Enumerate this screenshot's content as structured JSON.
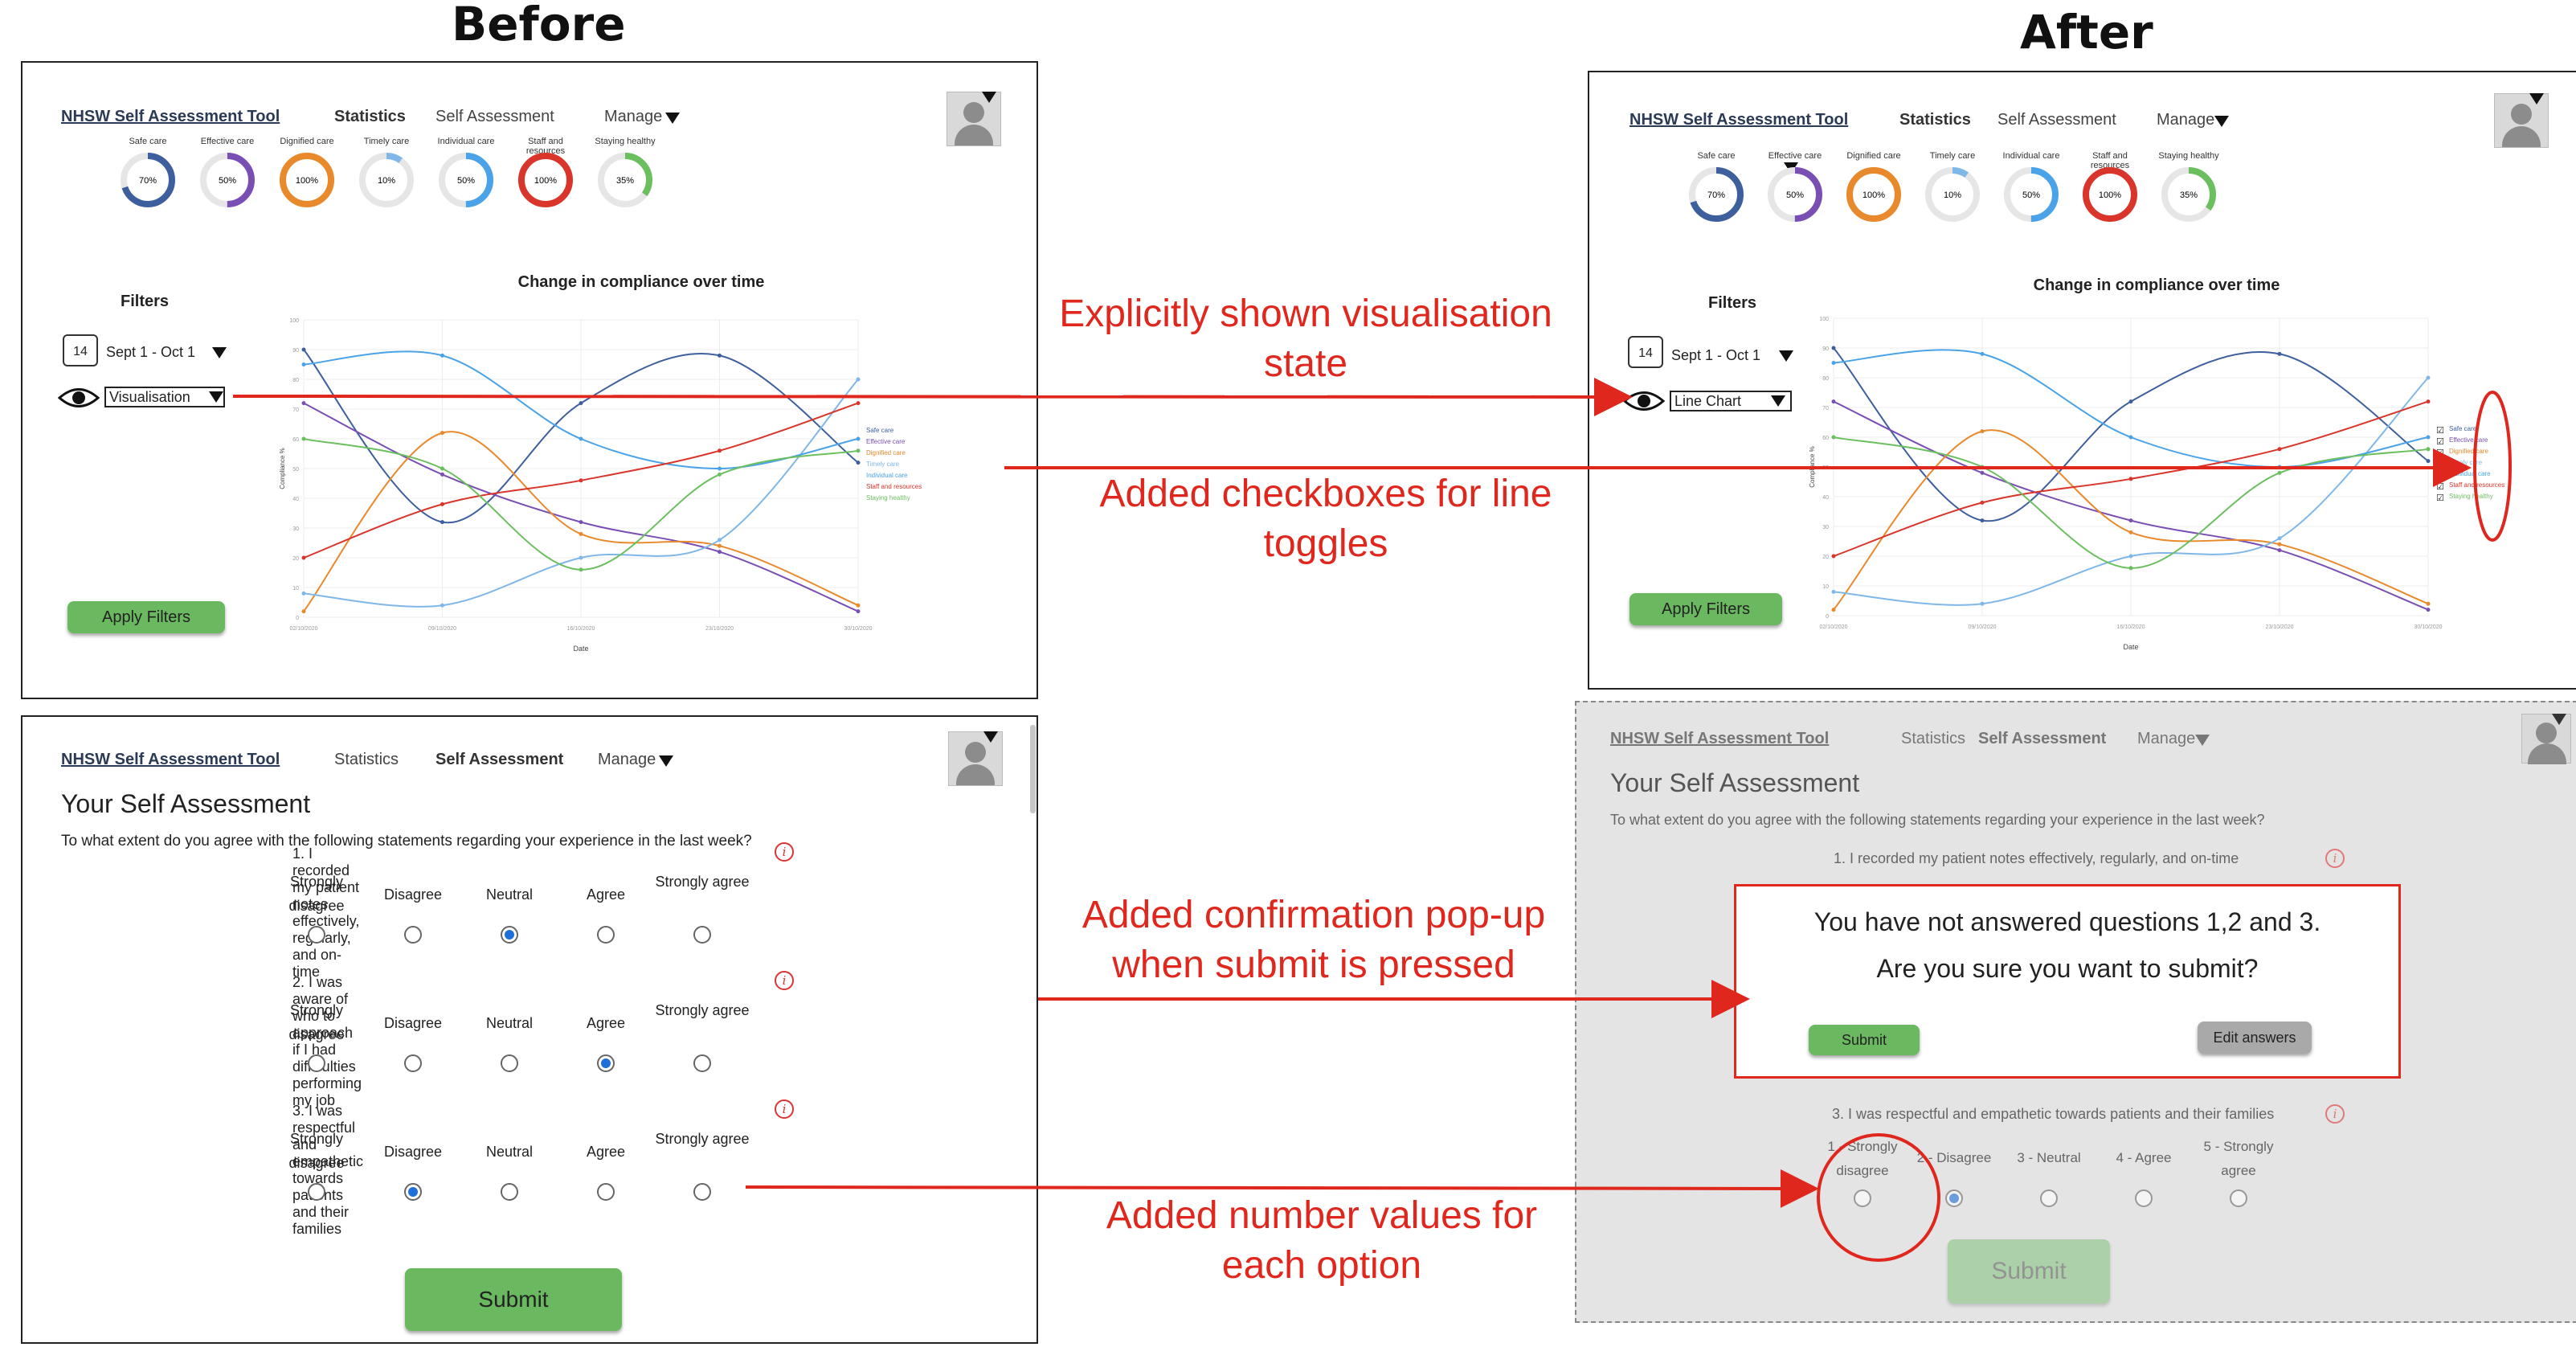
{
  "titles": {
    "before": "Before",
    "after": "After"
  },
  "app": {
    "title": "NHSW Self Assessment Tool",
    "nav": [
      "Statistics",
      "Self Assessment",
      "Manage"
    ]
  },
  "donuts": [
    {
      "label": "Safe care",
      "value": "70%",
      "color": "#3e5f9e"
    },
    {
      "label": "Effective care",
      "value": "50%",
      "color": "#7a4fb4"
    },
    {
      "label": "Dignified care",
      "value": "100%",
      "color": "#e8892c"
    },
    {
      "label": "Timely care",
      "value": "10%",
      "color": "#7fb7e8"
    },
    {
      "label": "Individual care",
      "value": "50%",
      "color": "#4aa3e8"
    },
    {
      "label": "Staff and resources",
      "value": "100%",
      "color": "#d9352b"
    },
    {
      "label": "Staying healthy",
      "value": "35%",
      "color": "#6bbf5f"
    }
  ],
  "filters": {
    "label": "Filters",
    "calendar_day": "14",
    "date_range": "Sept 1 - Oct 1",
    "visualisation_before": "Visualisation",
    "visualisation_after": "Line Chart",
    "apply": "Apply Filters"
  },
  "chart_data": {
    "type": "line",
    "title": "Change in compliance over time",
    "xlabel": "Date",
    "ylabel": "Compliance %",
    "x": [
      "02/10/2020",
      "09/10/2020",
      "16/10/2020",
      "23/10/2020",
      "30/10/2020"
    ],
    "ylim": [
      0,
      100
    ],
    "series": [
      {
        "name": "Safe care",
        "color": "#3e5f9e",
        "values": [
          90,
          32,
          72,
          88,
          52
        ]
      },
      {
        "name": "Effective care",
        "color": "#7a4fb4",
        "values": [
          72,
          48,
          32,
          22,
          2
        ]
      },
      {
        "name": "Dignified care",
        "color": "#e8892c",
        "values": [
          2,
          62,
          28,
          24,
          4
        ]
      },
      {
        "name": "Timely care",
        "color": "#7fb7e8",
        "values": [
          8,
          4,
          20,
          26,
          80
        ]
      },
      {
        "name": "Individual care",
        "color": "#4aa3e8",
        "values": [
          85,
          88,
          60,
          50,
          60
        ]
      },
      {
        "name": "Staff and resources",
        "color": "#d9352b",
        "values": [
          20,
          38,
          46,
          56,
          72
        ]
      },
      {
        "name": "Staying healthy",
        "color": "#6bbf5f",
        "values": [
          60,
          50,
          16,
          48,
          56
        ]
      }
    ]
  },
  "annotations": [
    "Explicitly shown visualisation state",
    "Added checkboxes for line toggles",
    "Added confirmation pop-up when submit is pressed",
    "Added number values for each option"
  ],
  "self_assessment": {
    "heading": "Your Self Assessment",
    "intro": "To what extent do you agree with the following statements regarding your experience in the last week?",
    "questions": [
      "1. I recorded my patient notes effectively, regularly, and on-time",
      "2. I was aware of who to approach if I had difficulties performing my job",
      "3. I was respectful and empathetic towards patients and their families"
    ],
    "options": [
      "Strongly disagree",
      "Disagree",
      "Neutral",
      "Agree",
      "Strongly agree"
    ],
    "options_numbered": [
      "1 - Strongly disagree",
      "2 - Disagree",
      "3 - Neutral",
      "4 - Agree",
      "5 - Strongly agree"
    ],
    "selected_before": [
      2,
      3,
      1
    ],
    "submit": "Submit"
  },
  "popup": {
    "line1": "You have not answered questions 1,2 and 3.",
    "line2": "Are you sure you want to submit?",
    "submit": "Submit",
    "edit": "Edit answers"
  }
}
